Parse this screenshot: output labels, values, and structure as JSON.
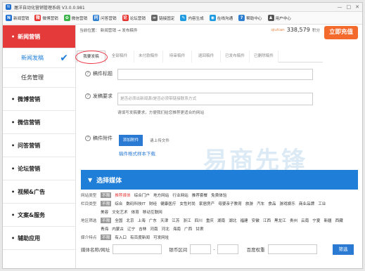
{
  "app": {
    "title": "屠洋自动化营销管理系统 V3.0.0.981",
    "icon_letter": "N"
  },
  "window_buttons": [
    "—",
    "□",
    "✕"
  ],
  "toolbar": [
    {
      "label": "新闻营销",
      "icon": "news-icon",
      "color": "#1e6fd0",
      "glyph": "N"
    },
    {
      "label": "微博营销",
      "icon": "weibo-icon",
      "color": "#e6322e",
      "glyph": "微"
    },
    {
      "label": "微信营销",
      "icon": "wechat-icon",
      "color": "#3bb44a",
      "glyph": "✿"
    },
    {
      "label": "问答营销",
      "icon": "qa-icon",
      "color": "#2f7fd1",
      "glyph": "问"
    },
    {
      "label": "论坛营销",
      "icon": "forum-icon",
      "color": "#e6322e",
      "glyph": "论"
    },
    {
      "label": "链接固定",
      "icon": "link-icon",
      "color": "#666666",
      "glyph": "∞"
    },
    {
      "label": "内容生成",
      "icon": "content-icon",
      "color": "#1e9be0",
      "glyph": "✎"
    },
    {
      "label": "在线沟通",
      "icon": "chat-icon",
      "color": "#1e9be0",
      "glyph": "◉"
    },
    {
      "label": "帮助中心",
      "icon": "help-icon",
      "color": "#2f7fd1",
      "glyph": "?"
    },
    {
      "label": "用户中心",
      "icon": "user-icon",
      "color": "#555555",
      "glyph": "♟"
    }
  ],
  "sidebar": {
    "items": [
      {
        "label": "新闻营销",
        "active": true
      },
      {
        "label": "新闻发稿",
        "sub": true,
        "current": true
      },
      {
        "label": "任务管理",
        "sub": true
      },
      {
        "label": "微博营销"
      },
      {
        "label": "微信营销"
      },
      {
        "label": "问答营销"
      },
      {
        "label": "论坛营销"
      },
      {
        "label": "视频&广告"
      },
      {
        "label": "文案&服务"
      },
      {
        "label": "辅助应用"
      }
    ]
  },
  "breadcrumb": "当前位置： 新闻营销 → 发布稿件",
  "user": {
    "name": "qiutian",
    "score": "338,579",
    "unit": "积分"
  },
  "charge_button": "立即充值",
  "tabs": [
    "我要发稿",
    "全部稿件",
    "未付款稿件",
    "待审稿件",
    "退回稿件",
    "已发布稿件",
    "已删除稿件"
  ],
  "form": {
    "title_label": "稿件标题",
    "req_label": "发稿要求",
    "req_placeholder": "是否必须出新闻源/是否必须带链接联系方式",
    "req_hint": "请填写发稿要求，方便我们给您推荐更适合的网站",
    "attach_label": "稿件附件",
    "upload_button": "添加附件",
    "upload_hint": "请上传文件",
    "template_link": "稿件格式样本下载"
  },
  "watermark": "易商先锋",
  "media": {
    "heading": "选择媒体",
    "filters": [
      {
        "label": "网站类型",
        "options": [
          "不限",
          "推荐媒体",
          "综合门户",
          "地方网站",
          "行业网站",
          "推荐套餐",
          "免费体验"
        ]
      },
      {
        "label": "栏目类型",
        "options": [
          "不限",
          "综合",
          "数码科技IT",
          "财经",
          "健康医疗",
          "女性时尚",
          "家居房产",
          "母婴亲子教育",
          "旅游",
          "汽车",
          "食品",
          "游戏娱乐",
          "商业品牌",
          "工业"
        ]
      },
      {
        "label": "",
        "options": [
          "美容",
          "文化艺术",
          "体育",
          "移动互联网"
        ]
      },
      {
        "label": "地区筛选",
        "options": [
          "不限",
          "全国",
          "北京",
          "上海",
          "广东",
          "天津",
          "江苏",
          "浙江",
          "四川",
          "重庆",
          "湖南",
          "湖北",
          "福建",
          "安徽",
          "江西",
          "黑龙江",
          "贵州",
          "云南",
          "宁夏",
          "新疆",
          "西藏"
        ]
      },
      {
        "label": "",
        "options": [
          "青海",
          "内蒙古",
          "辽宁",
          "吉林",
          "河南",
          "河北",
          "海南",
          "广西",
          "甘肃"
        ]
      },
      {
        "label": "媒介特点",
        "options": [
          "不限",
          "有入口",
          "有百度新闻",
          "可发网址"
        ]
      }
    ],
    "search": {
      "name_label": "媒体名称/网址",
      "price_label": "银币区间",
      "dash": "-",
      "weight_label": "百度权重",
      "button": "筛选"
    }
  }
}
